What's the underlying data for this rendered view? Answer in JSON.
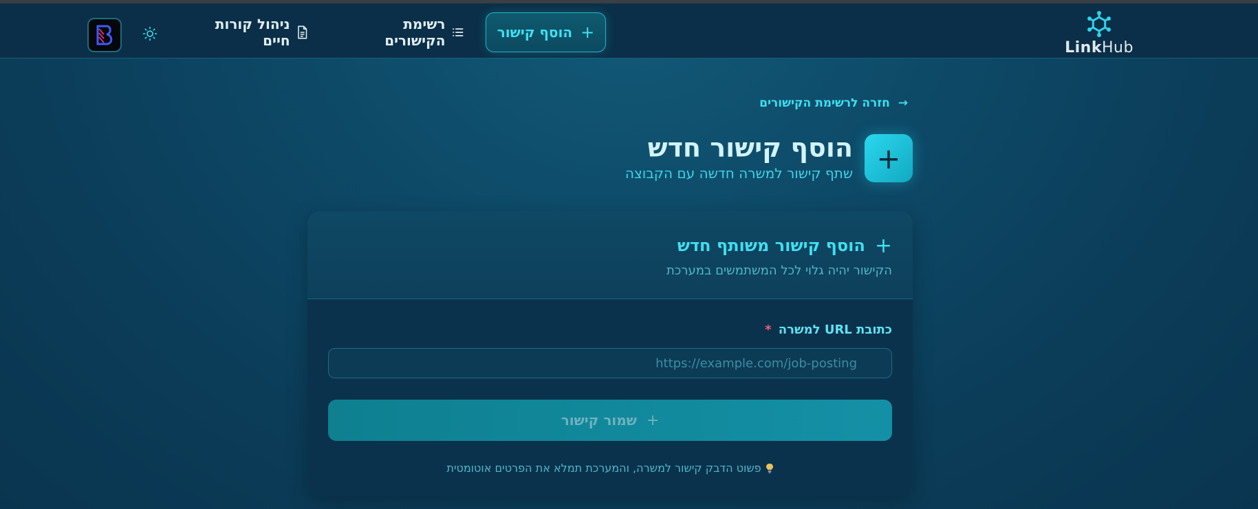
{
  "brand": {
    "name_bold": "Link",
    "name_light": "Hub"
  },
  "nav": {
    "add_link": "הוסף קישור",
    "links_list": "רשימת הקישורים",
    "cv_management": "ניהול קורות חיים"
  },
  "page": {
    "back_link": "חזרה לרשימת הקישורים",
    "title": "הוסף קישור חדש",
    "subtitle": "שתף קישור למשרה חדשה עם הקבוצה"
  },
  "card": {
    "title": "הוסף קישור משותף חדש",
    "subtitle": "הקישור יהיה גלוי לכל המשתמשים במערכת",
    "url_label": "כתובת URL למשרה",
    "required_mark": "*",
    "url_placeholder": "https://example.com/job-posting",
    "url_value": "",
    "save_button": "שמור קישור",
    "hint": "פשוט הדבק קישור למשרה, והמערכת תמלא את הפרטים אוטומטית"
  },
  "colors": {
    "accent": "#3fe0f0",
    "header_bg": "#0b2f48",
    "card_bg": "#0b324d",
    "required": "#f06070"
  },
  "icons": {
    "logo": "network-hub-icon",
    "add": "plus-icon",
    "list": "list-icon",
    "document": "document-icon",
    "theme": "sun-icon",
    "back": "arrow-right-icon",
    "hint": "lightbulb-icon"
  }
}
